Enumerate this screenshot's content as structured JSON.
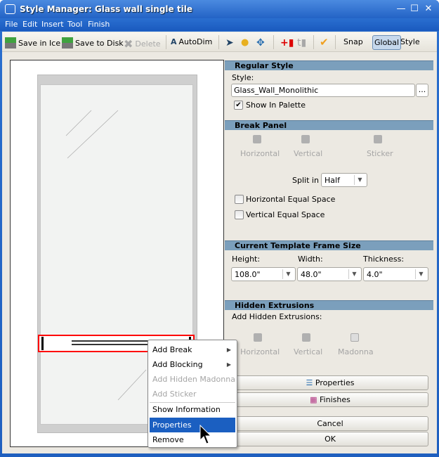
{
  "window": {
    "title": "Style Manager: Glass wall single tile",
    "minimize": "—",
    "maximize": "☐",
    "close": "✕"
  },
  "menu": [
    "File",
    "Edit",
    "Insert",
    "Tool",
    "Finish"
  ],
  "toolbar": {
    "save_ice": "Save in Ice",
    "save_disk": "Save to Disk",
    "delete": "Delete",
    "autodim": "AutoDim",
    "snap": "Snap",
    "global": "Global",
    "style": "Style"
  },
  "regular_style": {
    "header": "Regular Style",
    "style_label": "Style:",
    "style_value": "Glass_Wall_Monolithic",
    "browse": "...",
    "show_in_palette": "Show In Palette",
    "show_in_palette_checked": true
  },
  "break_panel": {
    "header": "Break Panel",
    "buttons": [
      "Horizontal",
      "Vertical",
      "Sticker"
    ],
    "split_label": "Split in",
    "split_value": "Half",
    "horizontal_equal": "Horizontal Equal Space",
    "vertical_equal": "Vertical Equal Space"
  },
  "frame_size": {
    "header": "Current Template Frame Size",
    "height_label": "Height:",
    "height_value": "108.0\"",
    "width_label": "Width:",
    "width_value": "48.0\"",
    "thickness_label": "Thickness:",
    "thickness_value": "4.0\""
  },
  "hidden_extrusions": {
    "header": "Hidden Extrusions",
    "label": "Add Hidden Extrusions:",
    "buttons": [
      "Horizontal",
      "Vertical",
      "Madonna"
    ]
  },
  "actions": {
    "properties": "Properties",
    "finishes": "Finishes",
    "cancel": "Cancel",
    "ok": "OK"
  },
  "context_menu": {
    "items": [
      "Add Break",
      "Add Blocking",
      "Add Hidden Madonna",
      "Add Sticker",
      "Show Information",
      "Properties",
      "Remove"
    ],
    "highlighted": "Properties"
  },
  "colors": {
    "title_bar": "#2363c6",
    "section_header": "#7b9fbc",
    "selection": "#1b5fc1",
    "selected_outline": "#ff0000"
  }
}
